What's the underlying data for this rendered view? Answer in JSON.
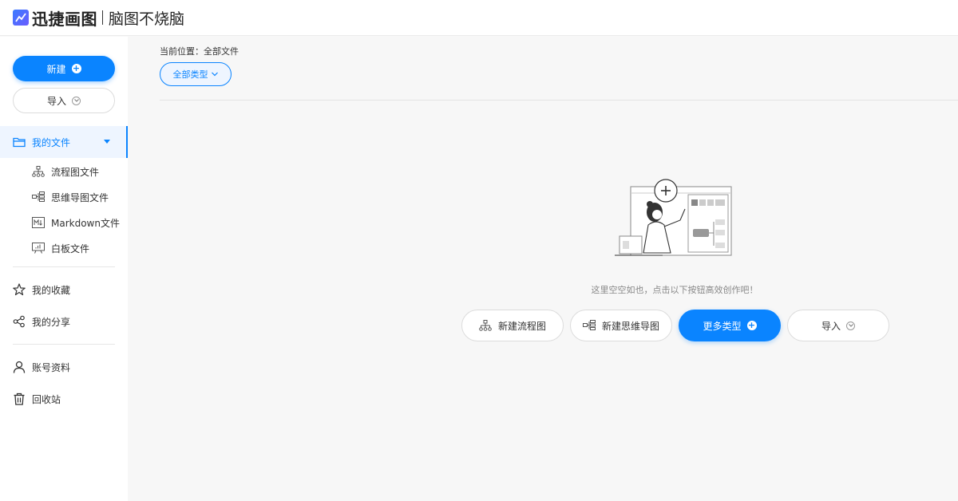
{
  "header": {
    "logo_text": "迅捷画图",
    "slogan": "脑图不烧脑"
  },
  "sidebar": {
    "new_label": "新建",
    "import_label": "导入",
    "my_files": "我的文件",
    "sub_items": [
      {
        "label": "流程图文件",
        "icon": "flowchart-icon"
      },
      {
        "label": "思维导图文件",
        "icon": "mindmap-icon"
      },
      {
        "label": "Markdown文件",
        "icon": "markdown-icon"
      },
      {
        "label": "白板文件",
        "icon": "whiteboard-icon"
      }
    ],
    "favorites": "我的收藏",
    "shares": "我的分享",
    "account": "账号资料",
    "trash": "回收站"
  },
  "main": {
    "breadcrumb": "当前位置：全部文件",
    "filter_label": "全部类型",
    "empty_text": "这里空空如也，点击以下按钮高效创作吧！",
    "actions": {
      "new_flowchart": "新建流程图",
      "new_mindmap": "新建思维导图",
      "more_types": "更多类型",
      "import": "导入"
    }
  },
  "colors": {
    "accent": "#0a84ff",
    "background": "#f7f7f7",
    "sidebar": "#ffffff"
  }
}
